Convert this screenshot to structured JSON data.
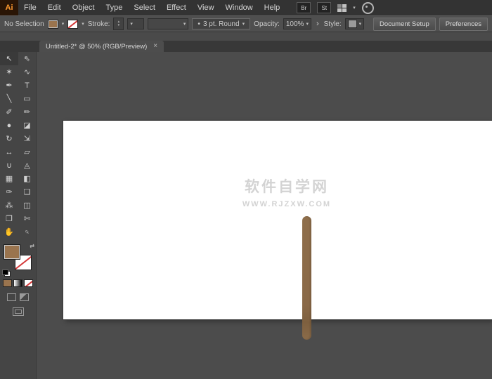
{
  "app": {
    "logo": "Ai",
    "menus": [
      "File",
      "Edit",
      "Object",
      "Type",
      "Select",
      "Effect",
      "View",
      "Window",
      "Help"
    ],
    "badges": {
      "bridge": "Br",
      "stock": "St"
    }
  },
  "control_bar": {
    "selection_status": "No Selection",
    "stroke_label": "Stroke:",
    "profile_button": "3 pt. Round",
    "opacity_label": "Opacity:",
    "opacity_value": "100%",
    "style_label": "Style:",
    "document_setup": "Document Setup",
    "preferences": "Preferences"
  },
  "tabs": [
    {
      "title": "Untitled-2* @ 50% (RGB/Preview)"
    }
  ],
  "tools": {
    "glyphs": [
      "↖",
      "⇖",
      "✶",
      "∿",
      "✒",
      "T",
      "╲",
      "▭",
      "✐",
      "✏",
      "●",
      "◪",
      "↻",
      "⇲",
      "↔",
      "▱",
      "∪",
      "◬",
      "▦",
      "◧",
      "✑",
      "❏",
      "⁂",
      "◫",
      "❐",
      "✄",
      "✋",
      "♀"
    ]
  },
  "icons": {
    "chevron_down": "▾",
    "spinner_up": "▴",
    "spinner_down": "▾",
    "swap": "⇄",
    "chevron_more": "›",
    "bullet": "•",
    "close": "×"
  },
  "watermark": {
    "line1": "软件自学网",
    "line2": "WWW.RJZXW.COM"
  },
  "colors": {
    "fill_brown": "#9A744E",
    "stick_brown": "#8B6A47",
    "stick_tip": "#7E603F",
    "accent_orange": "#FF9A2E",
    "artboard_white": "#FFFFFF",
    "canvas_gray": "#4C4C4C"
  }
}
